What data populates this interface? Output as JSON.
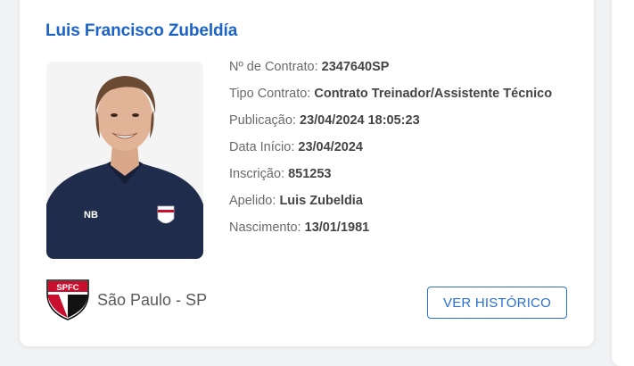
{
  "player": {
    "name": "Luis Francisco Zubeldía"
  },
  "contract": {
    "numero_label": "Nº de Contrato:",
    "numero_value": "2347640SP",
    "tipo_label": "Tipo Contrato:",
    "tipo_value": "Contrato Treinador/Assistente Técnico",
    "publicacao_label": "Publicação:",
    "publicacao_value": "23/04/2024 18:05:23",
    "data_inicio_label": "Data Início:",
    "data_inicio_value": "23/04/2024",
    "inscricao_label": "Inscrição:",
    "inscricao_value": "851253",
    "apelido_label": "Apelido:",
    "apelido_value": "Luis Zubeldia",
    "nascimento_label": "Nascimento:",
    "nascimento_value": "13/01/1981"
  },
  "club": {
    "name": "São Paulo - SP",
    "crest_text": "SPFC"
  },
  "actions": {
    "history_button": "VER HISTÓRICO"
  },
  "colors": {
    "accent": "#1b63c6",
    "button": "#2a6fd1",
    "shirt": "#1f2c4c"
  }
}
